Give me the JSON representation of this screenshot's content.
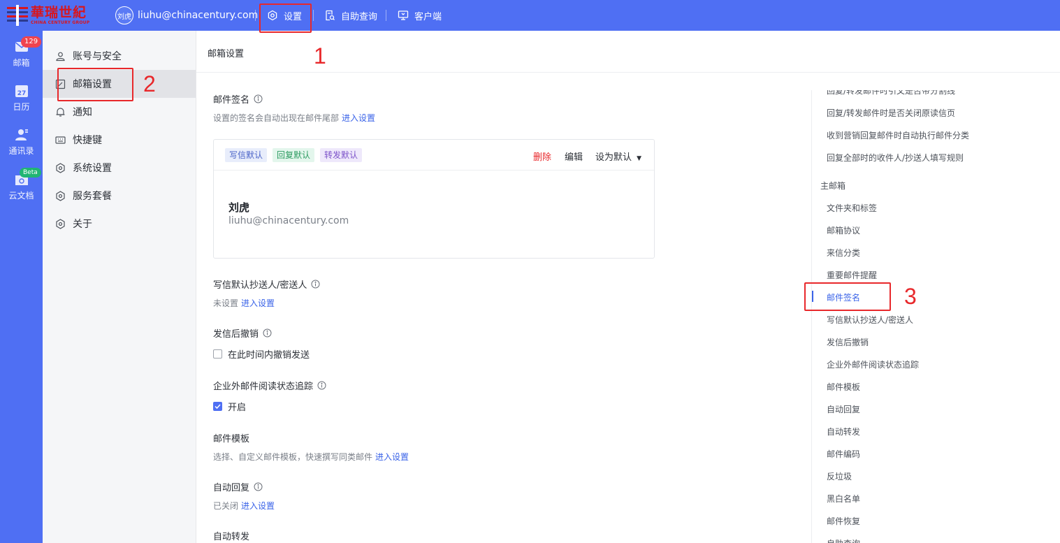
{
  "brand": {
    "name_cn": "華瑞世紀",
    "name_en": "CHINA CENTURY GROUP",
    "color": "#d8161e"
  },
  "user": {
    "avatar_text": "刘虎",
    "email": "liuhu@chinacentury.com"
  },
  "topnav": [
    {
      "label": "设置",
      "icon": "settings-icon"
    },
    {
      "label": "自助查询",
      "icon": "search-doc-icon"
    },
    {
      "label": "客户端",
      "icon": "monitor-icon"
    }
  ],
  "rail": [
    {
      "label": "邮箱",
      "badge": "129",
      "icon": "mail-icon"
    },
    {
      "label": "日历",
      "icon": "calendar-icon",
      "day": "27"
    },
    {
      "label": "通讯录",
      "icon": "contacts-icon"
    },
    {
      "label": "云文档",
      "badge": "Beta",
      "icon": "cloud-doc-icon"
    }
  ],
  "menu": [
    {
      "label": "账号与安全",
      "icon": "user-icon"
    },
    {
      "label": "邮箱设置",
      "icon": "edit-icon",
      "active": true
    },
    {
      "label": "通知",
      "icon": "bell-icon"
    },
    {
      "label": "快捷键",
      "icon": "keyboard-icon"
    },
    {
      "label": "系统设置",
      "icon": "settings-icon"
    },
    {
      "label": "服务套餐",
      "icon": "settings-icon"
    },
    {
      "label": "关于",
      "icon": "settings-icon"
    }
  ],
  "main": {
    "title": "邮箱设置",
    "signature": {
      "title": "邮件签名",
      "desc": "设置的签名会自动出现在邮件尾部",
      "link": "进入设置",
      "tags": [
        "写信默认",
        "回复默认",
        "转发默认"
      ],
      "actions": {
        "delete": "删除",
        "edit": "编辑",
        "set_default": "设为默认"
      },
      "name": "刘虎",
      "email": "liuhu@chinacentury.com"
    },
    "cc": {
      "title": "写信默认抄送人/密送人",
      "status": "未设置",
      "link": "进入设置"
    },
    "undo": {
      "title": "发信后撤销",
      "checkbox": "在此时间内撤销发送",
      "checked": false
    },
    "tracking": {
      "title": "企业外邮件阅读状态追踪",
      "checkbox": "开启",
      "checked": true
    },
    "template": {
      "title": "邮件模板",
      "desc": "选择、自定义邮件模板，快速撰写同类邮件",
      "link": "进入设置"
    },
    "autoreply": {
      "title": "自动回复",
      "status": "已关闭",
      "link": "进入设置"
    },
    "autoforward": {
      "title": "自动转发"
    }
  },
  "anchor": {
    "items_top": [
      "回复/转发邮件时引文是否带分割线",
      "回复/转发邮件时是否关闭原读信页",
      "收到营销回复邮件时自动执行邮件分类",
      "回复全部时的收件人/抄送人填写规则"
    ],
    "group": "主邮箱",
    "items": [
      "文件夹和标签",
      "邮箱协议",
      "来信分类",
      "重要邮件提醒",
      "邮件签名",
      "写信默认抄送人/密送人",
      "发信后撤销",
      "企业外邮件阅读状态追踪",
      "邮件模板",
      "自动回复",
      "自动转发",
      "邮件编码",
      "反垃圾",
      "黑白名单",
      "邮件恢复",
      "自助查询"
    ],
    "active_index": 4
  },
  "annotations": [
    "1",
    "2",
    "3"
  ],
  "colors": {
    "primary": "#4f6ff3",
    "link": "#3a63e8",
    "danger": "#e8282b",
    "annotation": "#e8282b"
  }
}
